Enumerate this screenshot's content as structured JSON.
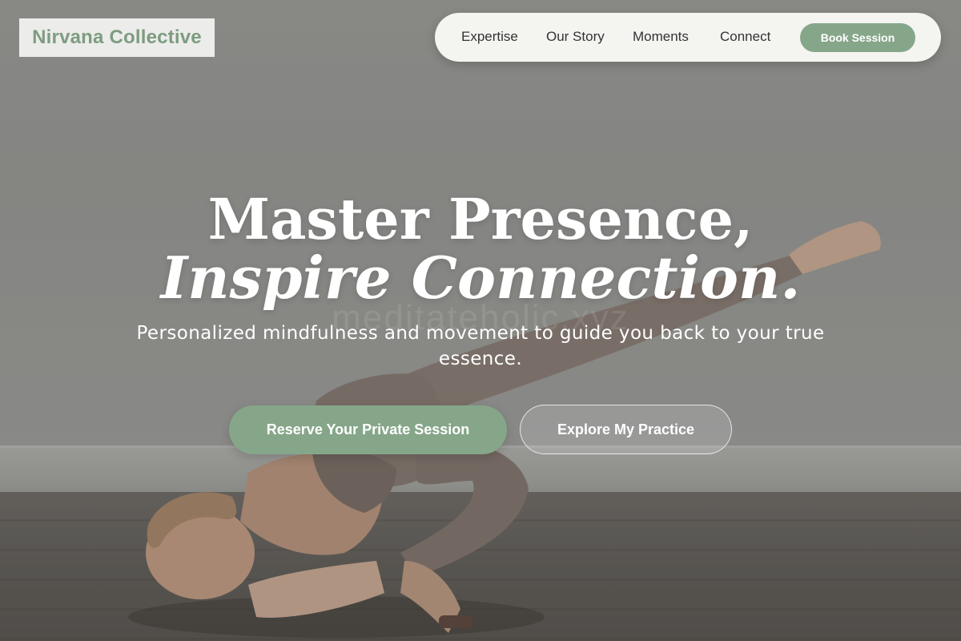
{
  "brand": {
    "name": "Nirvana Collective",
    "color": "#7d9c81"
  },
  "nav": {
    "items": [
      {
        "label": "Expertise"
      },
      {
        "label": "Our Story"
      },
      {
        "label": "Moments"
      },
      {
        "label": "Connect"
      }
    ],
    "cta_label": "Book Session"
  },
  "hero": {
    "title_line_1": "Master Presence,",
    "title_line_2": "Inspire Connection.",
    "subtitle": "Personalized mindfulness and movement to guide you back to your true essence.",
    "primary_button": "Reserve Your Private Session",
    "secondary_button": "Explore My Practice",
    "watermark": "meditateholic.xyz",
    "background_image": "woman-doing-yoga-arm-balance-photo"
  },
  "colors": {
    "accent": "#86a68a",
    "nav_background": "#f4f4f1",
    "text_light": "#ffffff",
    "text_dark": "#333333"
  }
}
